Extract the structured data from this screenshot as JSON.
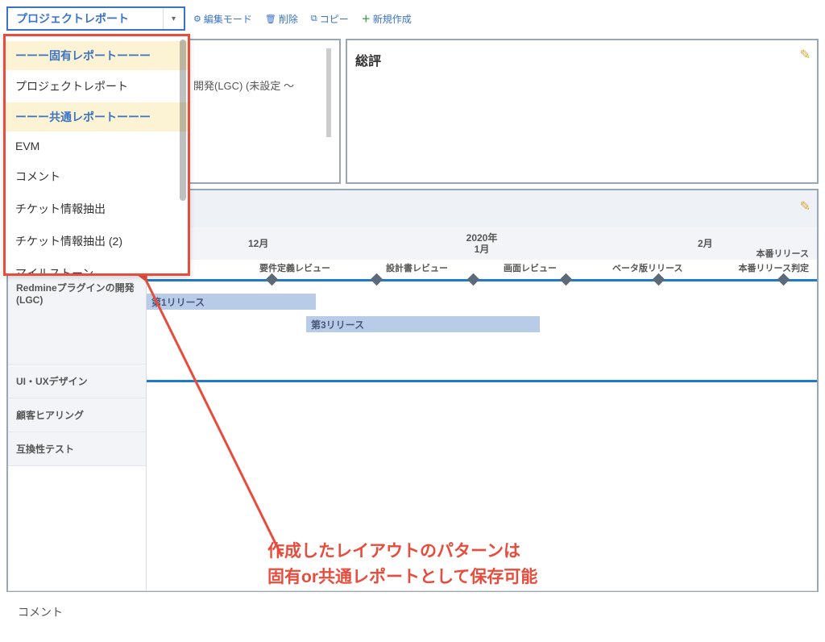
{
  "toolbar": {
    "report_selected": "プロジェクトレポート",
    "edit_mode": "編集モード",
    "delete": "削除",
    "copy": "コピー",
    "new": "新規作成"
  },
  "dropdown": {
    "header_specific": "ーーー固有レポートーーー",
    "items_specific": [
      "プロジェクトレポート"
    ],
    "header_common": "ーーー共通レポートーーー",
    "items_common": [
      "EVM",
      "コメント",
      "チケット情報抽出",
      "チケット情報抽出 (2)",
      "マイルストーン"
    ]
  },
  "left_panel": {
    "sub_line": "開発(LGC) (未設定 〜"
  },
  "right_panel": {
    "title": "総評"
  },
  "timeline": {
    "months": {
      "m1": "12月",
      "m2_top": "2020年",
      "m2_bottom": "1月",
      "m3": "2月"
    },
    "row1": "Redmineプラグインの開発(LGC)",
    "milestones": [
      "要件定義レビュー",
      "設計書レビュー",
      "画面レビュー",
      "ベータ版リリース",
      "本番リリース判定",
      "本番リリース"
    ],
    "bar1": "第1リリース",
    "bar2": "第3リリース",
    "row2": "UI・UXデザイン",
    "row3": "顧客ヒアリング",
    "row4": "互換性テスト",
    "comment": "コメント"
  },
  "annotation": {
    "line1": "作成したレイアウトのパターンは",
    "line2": "固有or共通レポートとして保存可能"
  }
}
